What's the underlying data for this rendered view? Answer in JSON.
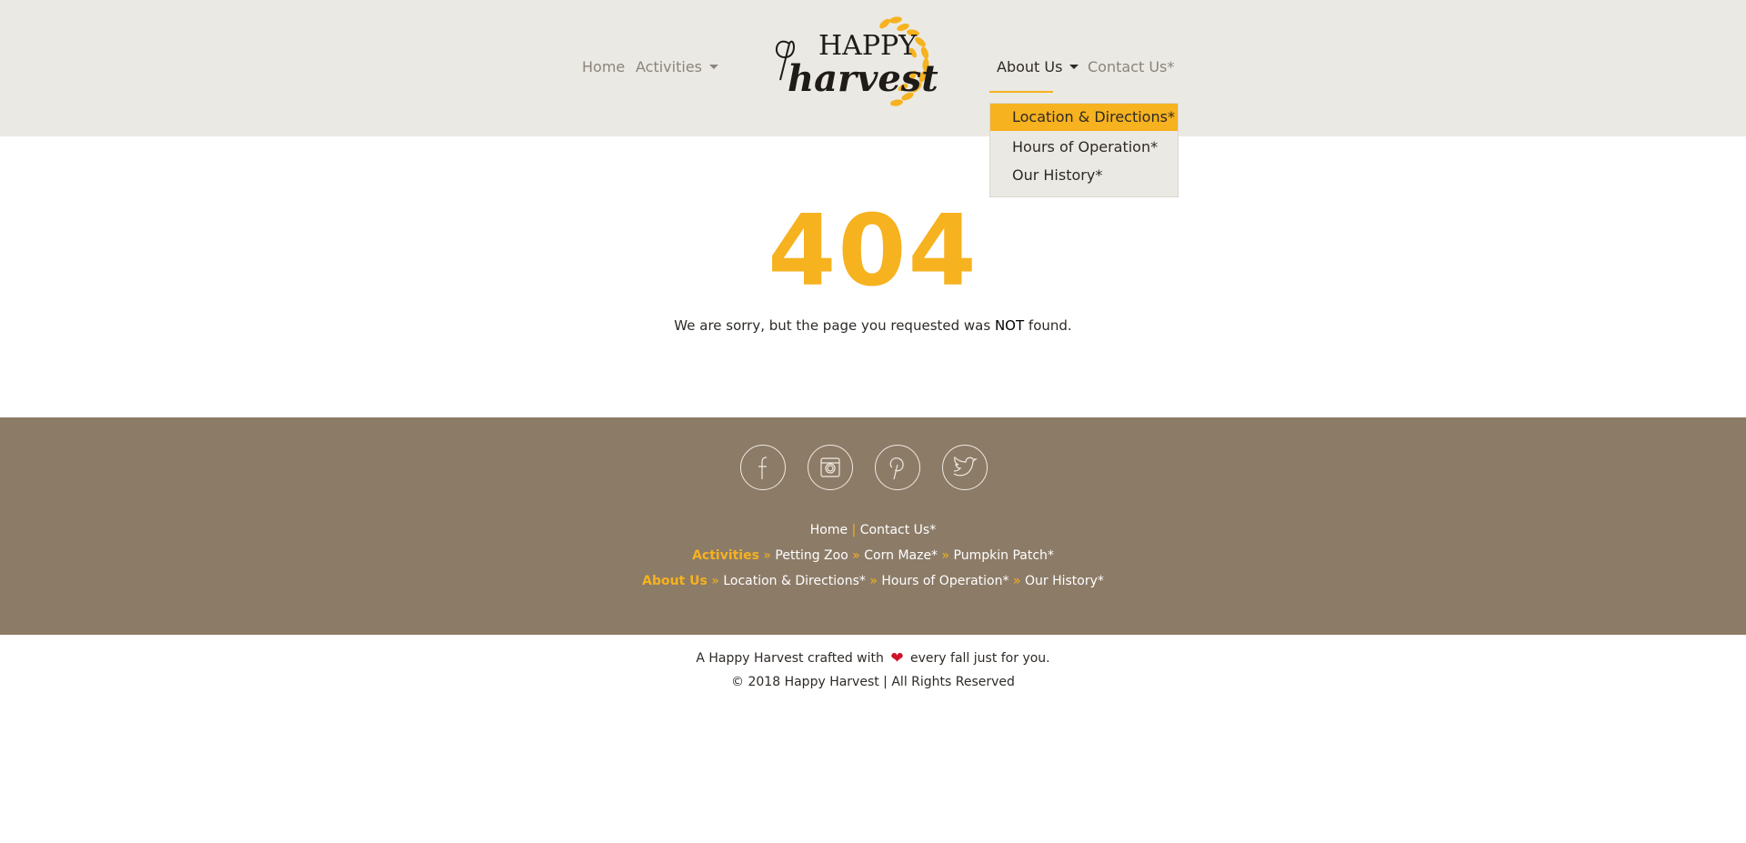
{
  "nav": {
    "home": "Home",
    "activities": "Activities",
    "about": "About Us",
    "contact": "Contact Us*"
  },
  "logo": {
    "line1": "HAPPY",
    "line2": "harvest"
  },
  "dropdown": {
    "items": [
      "Location & Directions*",
      "Hours of Operation*",
      "Our History*"
    ]
  },
  "error": {
    "code": "404",
    "message_before": "We are sorry, but the page you requested was ",
    "message_emphasis": "NOT",
    "message_after": " found."
  },
  "social": [
    "facebook-icon",
    "instagram-icon",
    "pinterest-icon",
    "twitter-icon"
  ],
  "footer": {
    "row1": {
      "home": "Home",
      "sep": "|",
      "contact": "Contact Us*"
    },
    "row2": {
      "heading": "Activities",
      "sep": "»",
      "items": [
        "Petting Zoo",
        "Corn Maze*",
        "Pumpkin Patch*"
      ]
    },
    "row3": {
      "heading": "About Us",
      "sep": "»",
      "items": [
        "Location & Directions*",
        "Hours of Operation*",
        "Our History*"
      ]
    }
  },
  "bottom": {
    "crafted_before": "A Happy Harvest crafted with",
    "crafted_after": "every fall just for you.",
    "copyright": "© 2018 Happy Harvest | All Rights Reserved"
  },
  "colors": {
    "accent": "#f6b21f",
    "header_bg": "#ebe9e3",
    "footer_bg": "#8c7b67",
    "heart": "#d0112b"
  }
}
